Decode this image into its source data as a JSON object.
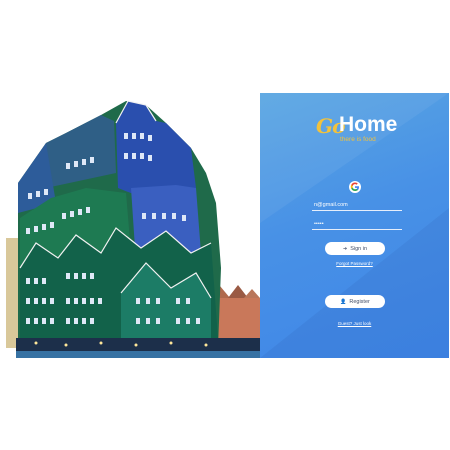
{
  "brand": {
    "logo_go": "Go",
    "logo_home": "Home",
    "tagline": "there is food",
    "accent_color": "#f2c23c",
    "panel_color": "#4891e6"
  },
  "login": {
    "google_icon": "google-icon",
    "email_value": "n@gmail.com",
    "password_value": "•••••",
    "sign_in_label": "Sign in",
    "sign_in_icon": "sign-in-icon",
    "forgot_label": "Forgot Password?",
    "register_label": "Register",
    "register_icon": "user-plus-icon",
    "guest_label": "Guest? Just look"
  },
  "photo": {
    "subject": "building-photo"
  }
}
